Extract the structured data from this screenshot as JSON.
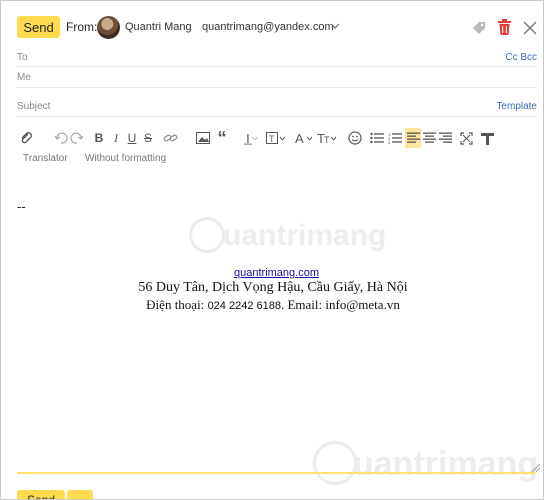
{
  "header": {
    "send_label": "Send",
    "from_label": "From:",
    "from_name": "Quantri Mang",
    "from_email": "quantrimang@yandex.com"
  },
  "fields": {
    "to_label": "To",
    "cc_bcc": "Cc Bcc",
    "me_label": "Me",
    "subject_label": "Subject",
    "template_label": "Template"
  },
  "toolbar": {
    "translator": "Translator",
    "without_formatting": "Without formatting",
    "icons": [
      "attach-icon",
      "undo-icon",
      "redo-icon",
      "bold-icon",
      "italic-icon",
      "underline-icon",
      "strikethrough-icon",
      "link-icon",
      "image-icon",
      "quote-icon",
      "text-size-icon",
      "text-style-icon",
      "font-color-icon",
      "font-family-icon",
      "emoji-icon",
      "numbered-list-icon",
      "bullet-list-icon",
      "align-left-icon",
      "align-center-icon",
      "align-right-icon",
      "fullscreen-icon",
      "clear-format-icon"
    ]
  },
  "body": {
    "separator": "--",
    "watermark": "uantrimang",
    "signature_link": "quantrimang.com",
    "signature_address": "56 Duy Tân, Dịch Vọng Hậu, Cầu Giấy, Hà Nội",
    "signature_phone_label": "Điện thoại:",
    "signature_phone": "024 2242 6188",
    "signature_email_part": ". Email: info@meta.vn"
  },
  "footer": {
    "send_label": "Send"
  },
  "colors": {
    "accent": "#ffdb4d",
    "link": "#3f6bb0",
    "danger": "#e53935"
  }
}
